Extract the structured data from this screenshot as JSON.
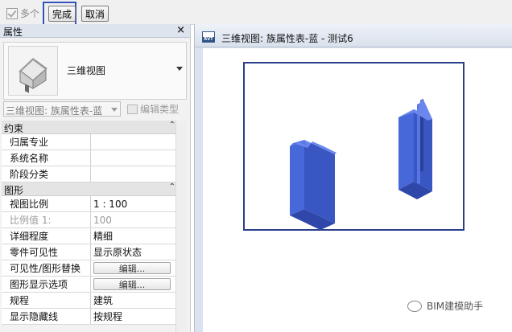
{
  "toolbar": {
    "multi_label": "多个",
    "multi_checked": true,
    "done_label": "完成",
    "cancel_label": "取消"
  },
  "properties": {
    "title": "属性",
    "close_glyph": "×",
    "type_name": "三维视图",
    "type_icon": "house-3d-icon",
    "view_selector": "三维视图: 族属性表-蓝",
    "edit_type_label": "编辑类型",
    "sections": [
      {
        "label": "约束",
        "rows": [
          {
            "key": "归属专业",
            "value": ""
          },
          {
            "key": "系统名称",
            "value": ""
          },
          {
            "key": "阶段分类",
            "value": ""
          }
        ]
      },
      {
        "label": "图形",
        "rows": [
          {
            "key": "视图比例",
            "value": "1 : 100"
          },
          {
            "key": "比例值 1:",
            "value": "100"
          },
          {
            "key": "详细程度",
            "value": "精细"
          },
          {
            "key": "零件可见性",
            "value": "显示原状态"
          },
          {
            "key": "可见性/图形替换",
            "value": "编辑..."
          },
          {
            "key": "图形显示选项",
            "value": "编辑..."
          },
          {
            "key": "规程",
            "value": "建筑"
          },
          {
            "key": "显示隐藏线",
            "value": "按规程"
          }
        ]
      }
    ],
    "collapse_glyph": "⌃"
  },
  "view_window": {
    "title": "三维视图: 族属性表-蓝 - 测试6",
    "icon_label": "RVT",
    "accent_color": "#3b5bd6",
    "crop_color": "#2b3f8c"
  },
  "watermark": {
    "text": "BIM建模助手"
  }
}
